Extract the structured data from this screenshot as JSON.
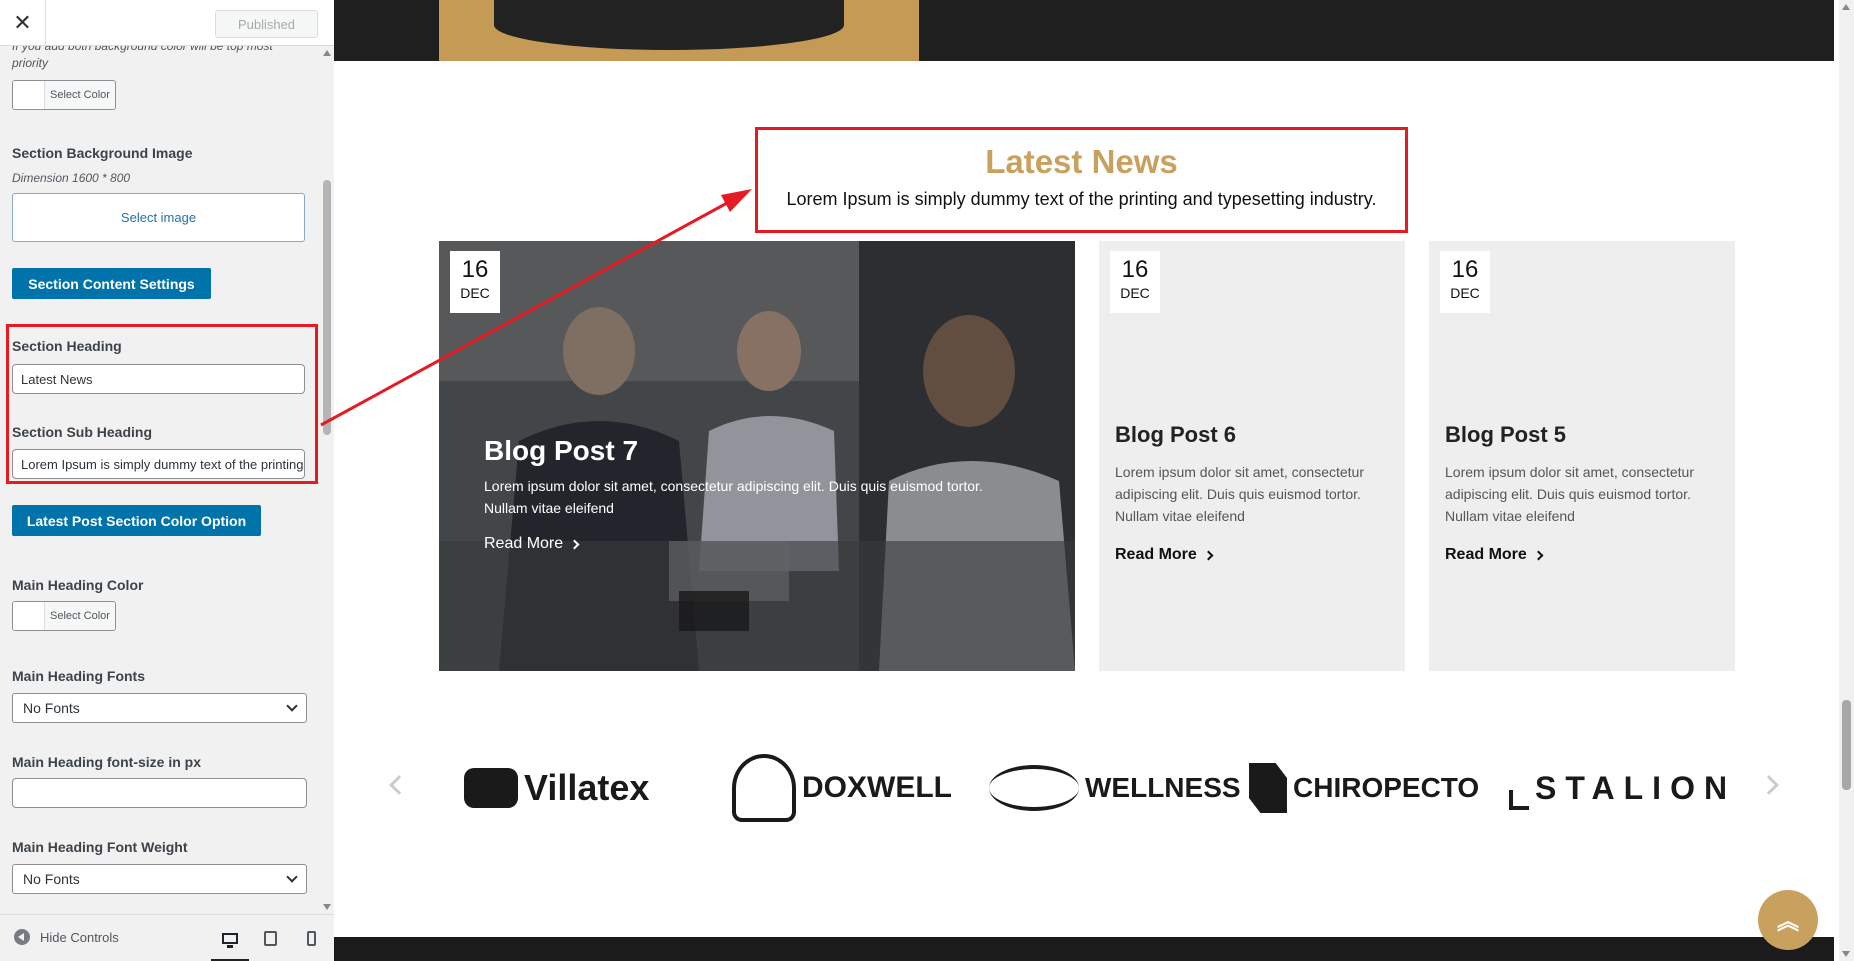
{
  "customizer": {
    "close_glyph": "✕",
    "publish_label": "Published",
    "truncated_note": "If you add both background color will be top most priority",
    "bg_color_button": "Select Color",
    "bg_image_label": "Section Background Image",
    "bg_image_dimension": "Dimension 1600 * 800",
    "select_image_label": "Select image",
    "content_settings_button": "Section Content Settings",
    "section_heading_label": "Section Heading",
    "section_heading_value": "Latest News",
    "section_subheading_label": "Section Sub Heading",
    "section_subheading_value": "Lorem Ipsum is simply dummy text of the printing and typesetting industry.",
    "color_option_button": "Latest Post Section Color Option",
    "main_heading_color_label": "Main Heading Color",
    "main_heading_color_button": "Select Color",
    "main_heading_fonts_label": "Main Heading Fonts",
    "main_heading_fonts_value": "No Fonts",
    "main_heading_size_label": "Main Heading font-size in px",
    "main_heading_size_value": "",
    "main_heading_weight_label": "Main Heading Font Weight",
    "main_heading_weight_value": "No Fonts",
    "hide_controls_label": "Hide Controls",
    "devices": [
      "desktop-icon",
      "tablet-icon",
      "mobile-icon"
    ]
  },
  "preview": {
    "section_title": "Latest News",
    "section_subtitle": "Lorem Ipsum is simply dummy text of the printing and typesetting industry.",
    "posts": [
      {
        "day": "16",
        "month": "DEC",
        "title": "Blog Post 7",
        "excerpt": "Lorem ipsum dolor sit amet, consectetur adipiscing elit. Duis quis euismod tortor. Nullam vitae eleifend",
        "read_more": "Read More"
      },
      {
        "day": "16",
        "month": "DEC",
        "title": "Blog Post 6",
        "excerpt": "Lorem ipsum dolor sit amet, consectetur adipiscing elit. Duis quis euismod tortor. Nullam vitae eleifend",
        "read_more": "Read More"
      },
      {
        "day": "16",
        "month": "DEC",
        "title": "Blog Post 5",
        "excerpt": "Lorem ipsum dolor sit amet, consectetur adipiscing elit. Duis quis euismod tortor. Nullam vitae eleifend",
        "read_more": "Read More"
      }
    ],
    "logos": [
      "Villatex",
      "DOXWELL",
      "WELLNESS",
      "CHIROPECTO",
      "STALION"
    ],
    "back_to_top_glyph": "︽"
  },
  "colors": {
    "accent_gold": "#c9a15e",
    "admin_blue": "#0073aa",
    "highlight_red": "#e51b23"
  }
}
